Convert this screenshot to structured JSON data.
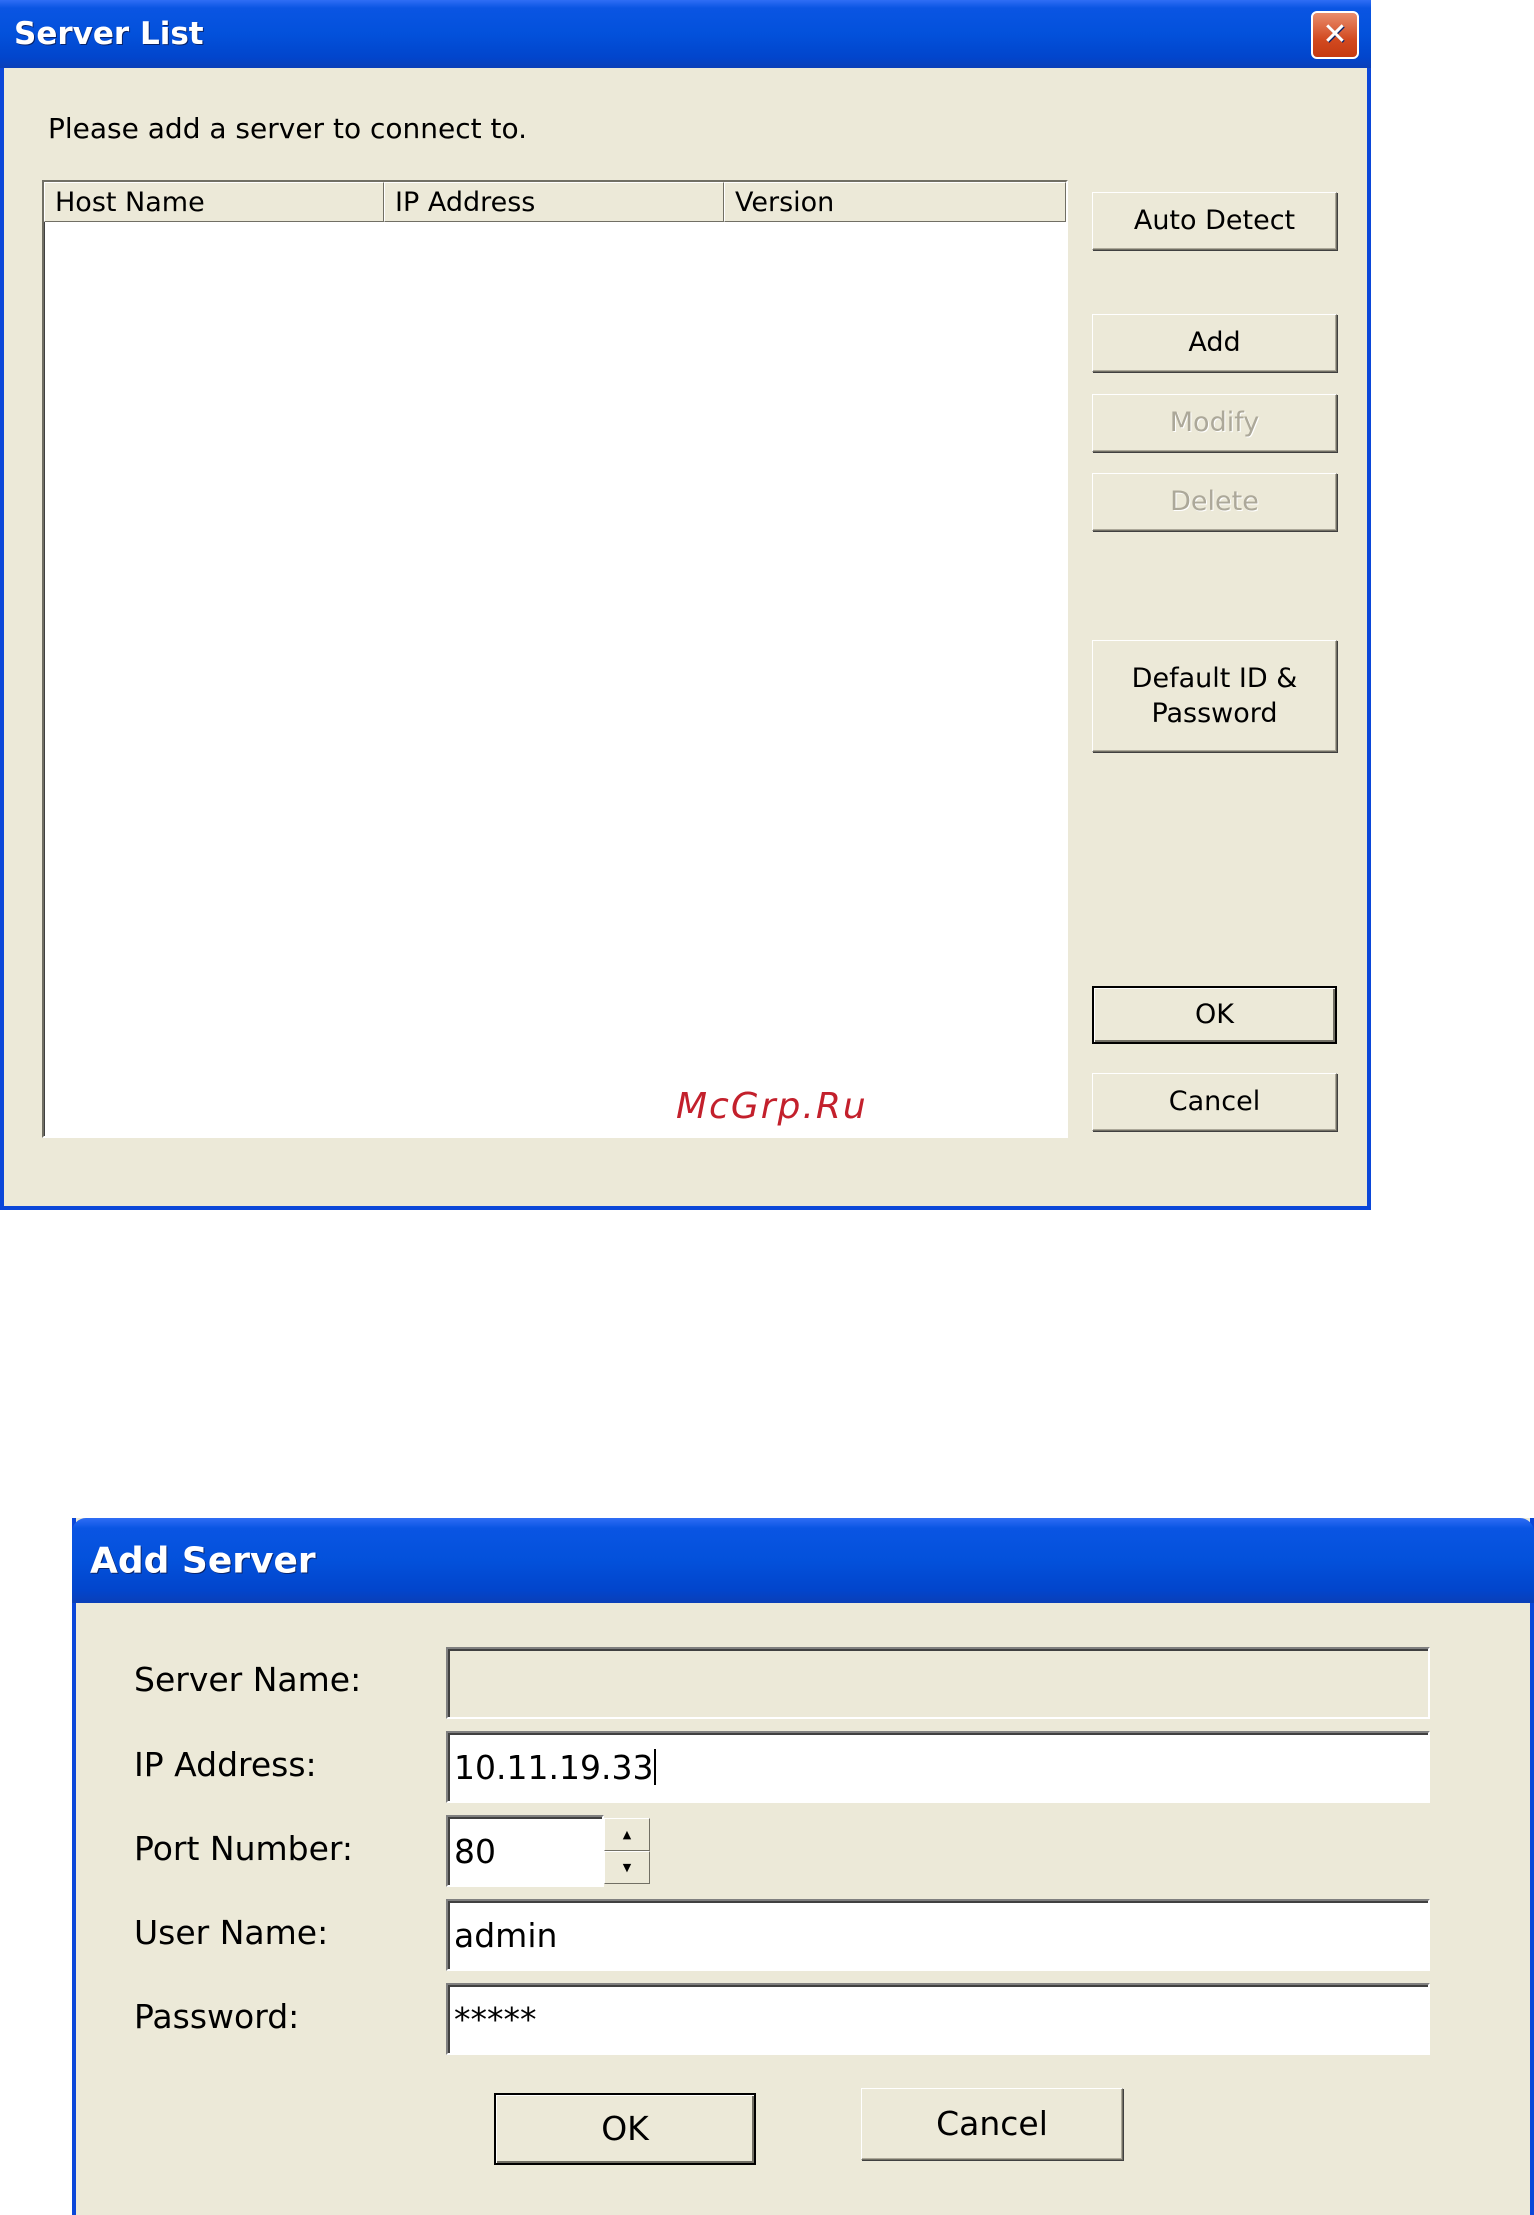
{
  "server_list": {
    "title": "Server List",
    "prompt": "Please add a server to connect to.",
    "columns": [
      "Host Name",
      "IP Address",
      "Version"
    ],
    "buttons": {
      "auto_detect": "Auto Detect",
      "add": "Add",
      "modify": "Modify",
      "delete": "Delete",
      "default_id_line1": "Default ID &",
      "default_id_line2": "Password",
      "ok": "OK",
      "cancel": "Cancel"
    },
    "close_glyph": "✕"
  },
  "watermark": "McGrp.Ru",
  "add_server": {
    "title": "Add Server",
    "labels": {
      "server_name": "Server Name:",
      "ip_address": "IP Address:",
      "port_number": "Port Number:",
      "user_name": "User Name:",
      "password": "Password:"
    },
    "values": {
      "server_name": "",
      "ip_address": "10.11.19.33",
      "port_number": "80",
      "user_name": "admin",
      "password": "*****"
    },
    "buttons": {
      "ok": "OK",
      "cancel": "Cancel"
    }
  },
  "colors": {
    "title_bar": "#0351db",
    "face": "#ece9d8",
    "close_button": "#d24a20",
    "watermark": "#c3202c"
  }
}
